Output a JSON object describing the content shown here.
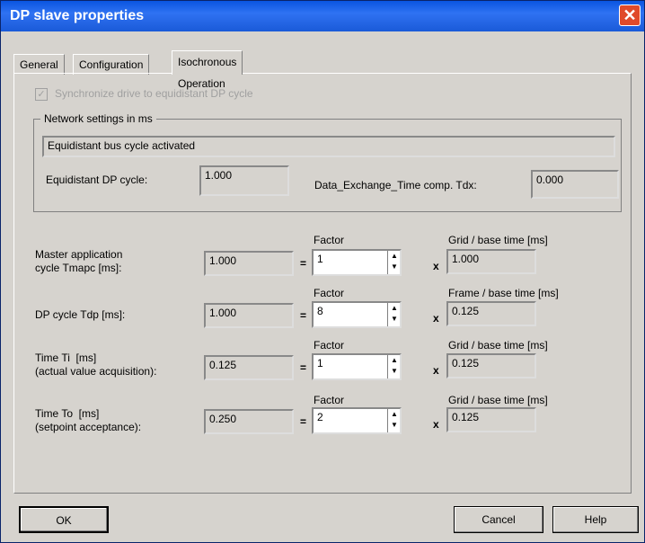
{
  "window": {
    "title": "DP slave properties",
    "close_icon": "close-icon"
  },
  "tabs": [
    "General",
    "Configuration",
    "Isochronous Operation"
  ],
  "sync_checkbox": {
    "label": "Synchronize drive to equidistant DP cycle",
    "checked": true
  },
  "network": {
    "group_label": "Network settings in ms",
    "status": "Equidistant bus cycle activated",
    "dp_cycle_label": "Equidistant DP cycle:",
    "dp_cycle_value": "1.000",
    "tdx_label": "Data_Exchange_Time comp. Tdx:",
    "tdx_value": "0.000"
  },
  "rows": [
    {
      "label": "Master application\ncycle Tmapc [ms]:",
      "value": "1.000",
      "factor_label": "Factor",
      "factor": "1",
      "base_label": "Grid / base time [ms]",
      "base_value": "1.000"
    },
    {
      "label": "DP cycle Tdp [ms]:",
      "value": "1.000",
      "factor_label": "Factor",
      "factor": "8",
      "base_label": "Frame / base time [ms]",
      "base_value": "0.125"
    },
    {
      "label": "Time Ti  [ms]\n(actual value acquisition):",
      "value": "0.125",
      "factor_label": "Factor",
      "factor": "1",
      "base_label": "Grid / base time [ms]",
      "base_value": "0.125"
    },
    {
      "label": "Time To  [ms]\n(setpoint acceptance):",
      "value": "0.250",
      "factor_label": "Factor",
      "factor": "2",
      "base_label": "Grid / base time [ms]",
      "base_value": "0.125"
    }
  ],
  "ops": {
    "equals": "=",
    "times": "x"
  },
  "buttons": {
    "ok": "OK",
    "cancel": "Cancel",
    "help": "Help"
  }
}
